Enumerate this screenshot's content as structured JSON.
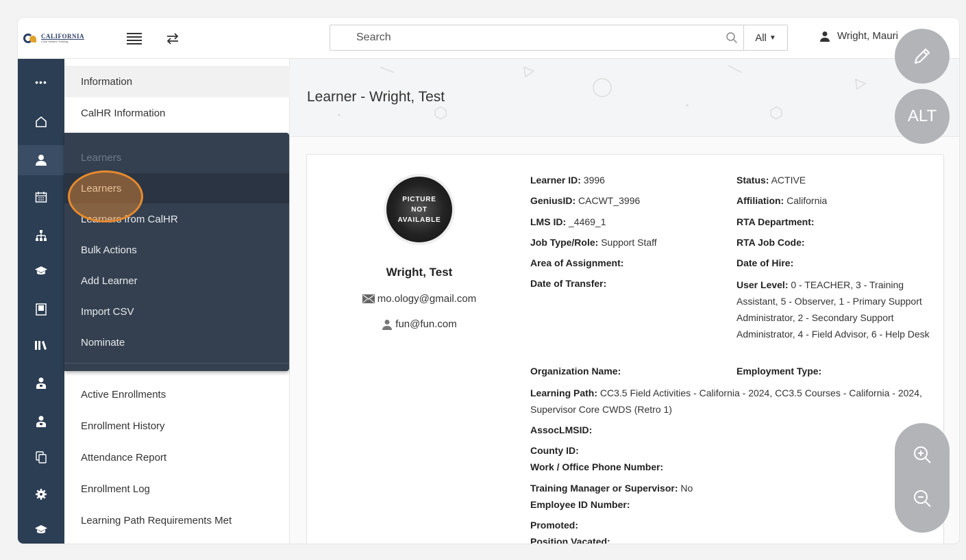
{
  "header": {
    "logo_line1": "CALIFORNIA",
    "logo_line2": "Child Welfare Training",
    "search_placeholder": "Search",
    "scope_label": "All",
    "user_name": "Wright, Mauri"
  },
  "rail": {
    "icons": [
      "more-icon",
      "home-icon",
      "learner-icon",
      "calendar-icon",
      "org-chart-icon",
      "graduation-cap-icon",
      "book-icon",
      "library-icon",
      "instructor-icon",
      "instructor-icon-2",
      "copy-icon",
      "gear-icon",
      "graduation-cap-icon-2"
    ]
  },
  "submenu": {
    "items": [
      "Information",
      "CalHR Information",
      "",
      "",
      "",
      "",
      "",
      "",
      "",
      "Active Enrollments",
      "Enrollment History",
      "Attendance Report",
      "Enrollment Log",
      "Learning Path Requirements Met"
    ]
  },
  "flyout": {
    "header": "Learners",
    "items": [
      "Learners",
      "Learners from CalHR",
      "Bulk Actions",
      "Add Learner",
      "Import CSV",
      "Nominate"
    ]
  },
  "page": {
    "title": "Learner - Wright, Test"
  },
  "learner": {
    "avatar_text": [
      "PICTURE",
      "NOT",
      "AVAILABLE"
    ],
    "name": "Wright, Test",
    "email": "mo.ology@gmail.com",
    "username": "fun@fun.com",
    "fields_left": [
      {
        "label": "Learner ID:",
        "value": " 3996"
      },
      {
        "label": "GeniusID:",
        "value": " CACWT_3996"
      },
      {
        "label": "LMS ID:",
        "value": " _4469_1"
      },
      {
        "label": "Job Type/Role:",
        "value": " Support Staff"
      },
      {
        "label": "Area of Assignment:",
        "value": ""
      },
      {
        "label": "Date of Transfer:",
        "value": ""
      }
    ],
    "fields_right": [
      {
        "label": "Status:",
        "value": " ACTIVE"
      },
      {
        "label": "Affiliation:",
        "value": " California"
      },
      {
        "label": "RTA Department:",
        "value": ""
      },
      {
        "label": "RTA Job Code:",
        "value": ""
      },
      {
        "label": "Date of Hire:",
        "value": ""
      },
      {
        "label": "User Level:",
        "value": " 0 - TEACHER, 3 - Training Assistant, 5 - Observer, 1 - Primary Support Administrator, 2 - Secondary Support Administrator, 4 - Field Advisor, 6 - Help Desk"
      }
    ],
    "org_name": {
      "label": "Organization Name:",
      "value": ""
    },
    "employment_type": {
      "label": "Employment Type:",
      "value": ""
    },
    "learning_path": {
      "label": "Learning Path:",
      "value": " CC3.5 Field Activities - California - 2024, CC3.5 Courses - California - 2024, Supervisor Core CWDS (Retro 1)"
    },
    "assoc_lmsid": {
      "label": "AssocLMSID:",
      "value": ""
    },
    "county_id": {
      "label": "County ID:",
      "value": ""
    },
    "work_phone": {
      "label": "Work / Office Phone Number:",
      "value": ""
    },
    "training_manager": {
      "label": "Training Manager or Supervisor:",
      "value": " No"
    },
    "employee_id": {
      "label": "Employee ID Number:",
      "value": ""
    },
    "promoted": {
      "label": "Promoted:",
      "value": ""
    },
    "position_vacated": {
      "label": "Position Vacated:",
      "value": ""
    }
  },
  "fab": {
    "alt_label": "ALT"
  }
}
